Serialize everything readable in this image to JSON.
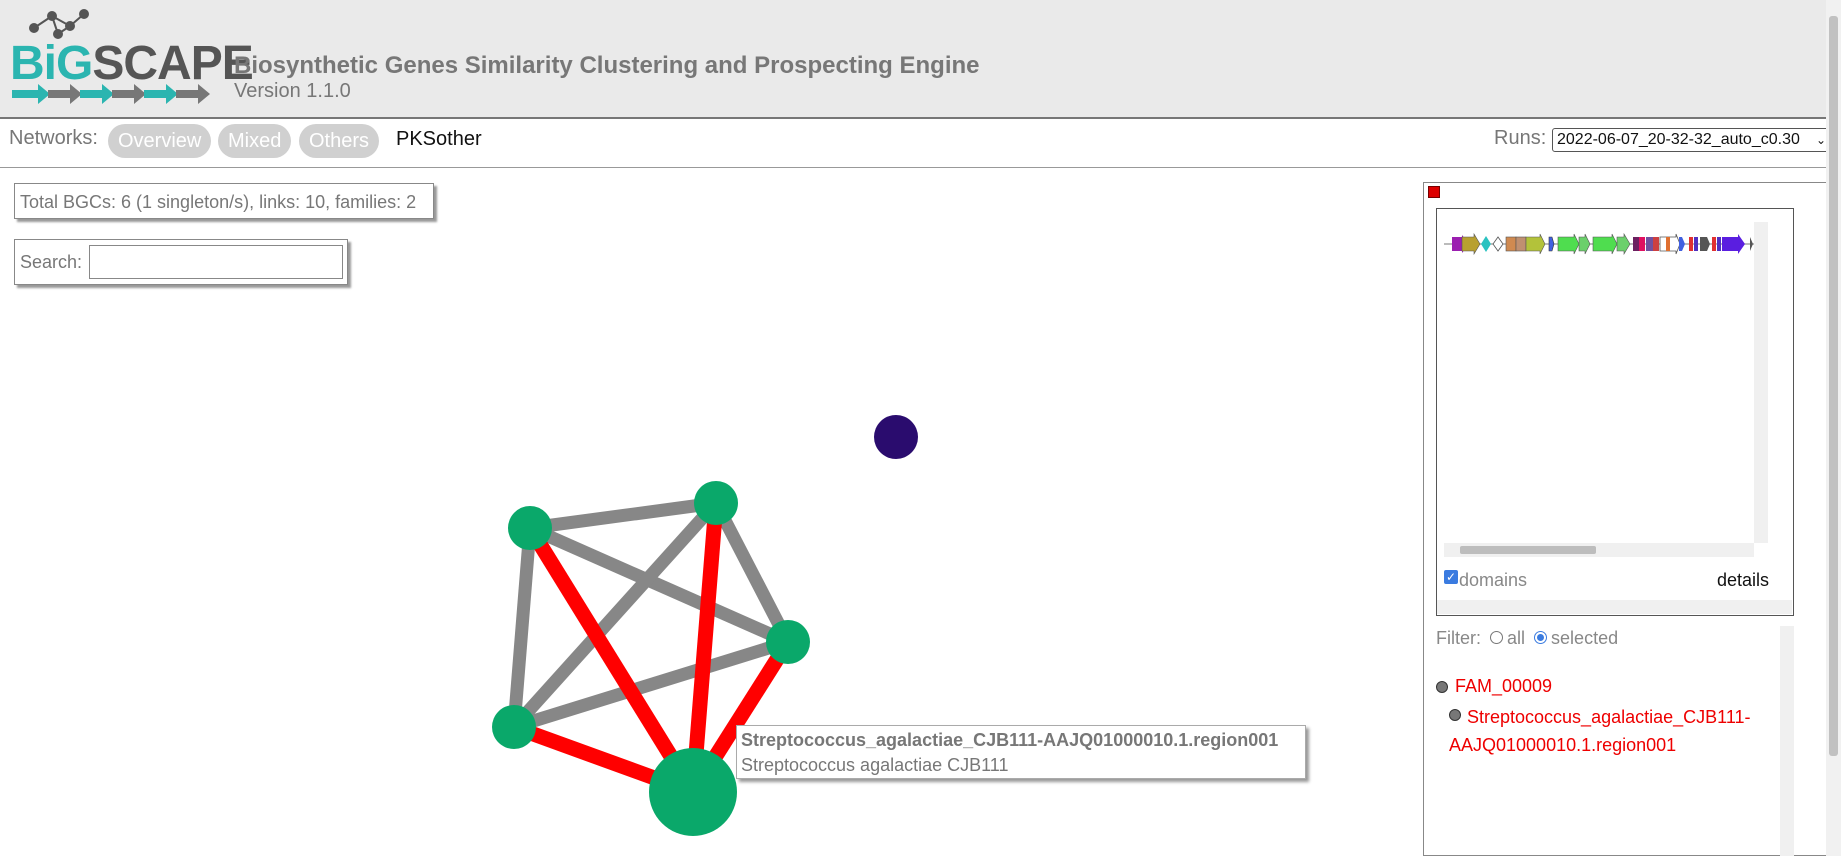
{
  "header": {
    "logo_big": "BiG",
    "logo_scape": "SCAPE",
    "title": "Biosynthetic Genes Similarity Clustering and Prospecting Engine",
    "version": "Version 1.1.0"
  },
  "nav": {
    "label": "Networks:",
    "tabs": [
      "Overview",
      "Mixed",
      "Others"
    ],
    "current": "PKSother",
    "runs_label": "Runs:",
    "runs_selected": "2022-06-07_20-32-32_auto_c0.30"
  },
  "stats": "Total BGCs: 6 (1 singleton/s), links: 10, families: 2",
  "search": {
    "label": "Search:",
    "value": ""
  },
  "tooltip": {
    "name": "Streptococcus_agalactiae_CJB111-AAJQ01000010.1.region001",
    "organism": "Streptococcus agalactiae CJB111"
  },
  "panel": {
    "domains_label": "domains",
    "domains_checked": true,
    "details_label": "details",
    "filter_label": "Filter:",
    "filter_all": "all",
    "filter_selected": "selected",
    "filter_value": "selected",
    "family": "FAM_00009",
    "bgc": "Streptococcus_agalactiae_CJB111-AAJQ01000010.1.region001"
  },
  "colors": {
    "node_green": "#0aa86a",
    "node_purple": "#2a0c6e",
    "edge_gray": "#878787",
    "edge_red": "#ff0000",
    "selection_red": "#e00000"
  }
}
